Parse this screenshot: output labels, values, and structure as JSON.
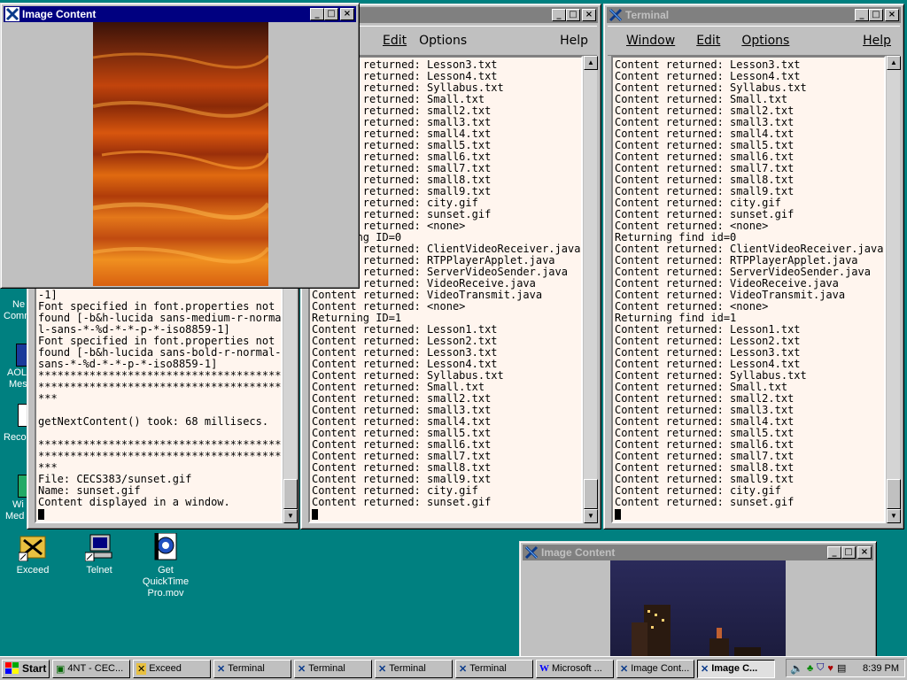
{
  "terminal_mid": {
    "menu": [
      "Edit",
      "Options",
      "Help"
    ],
    "lines": [
      "Content returned: Lesson3.txt",
      "Content returned: Lesson4.txt",
      "Content returned: Syllabus.txt",
      "Content returned: Small.txt",
      "Content returned: small2.txt",
      "Content returned: small3.txt",
      "Content returned: small4.txt",
      "Content returned: small5.txt",
      "Content returned: small6.txt",
      "Content returned: small7.txt",
      "Content returned: small8.txt",
      "Content returned: small9.txt",
      "Content returned: city.gif",
      "Content returned: sunset.gif",
      "Content returned: <none>",
      "Returning ID=0",
      "Content returned: ClientVideoReceiver.java",
      "Content returned: RTPPlayerApplet.java",
      "Content returned: ServerVideoSender.java",
      "Content returned: VideoReceive.java",
      "Content returned: VideoTransmit.java",
      "Content returned: <none>",
      "Returning ID=1",
      "Content returned: Lesson1.txt",
      "Content returned: Lesson2.txt",
      "Content returned: Lesson3.txt",
      "Content returned: Lesson4.txt",
      "Content returned: Syllabus.txt",
      "Content returned: Small.txt",
      "Content returned: small2.txt",
      "Content returned: small3.txt",
      "Content returned: small4.txt",
      "Content returned: small5.txt",
      "Content returned: small6.txt",
      "Content returned: small7.txt",
      "Content returned: small8.txt",
      "Content returned: small9.txt",
      "Content returned: city.gif",
      "Content returned: sunset.gif"
    ]
  },
  "terminal_right": {
    "title": "Terminal",
    "menu": [
      "Window",
      "Edit",
      "Options",
      "Help"
    ],
    "lines": [
      "Content returned: Lesson3.txt",
      "Content returned: Lesson4.txt",
      "Content returned: Syllabus.txt",
      "Content returned: Small.txt",
      "Content returned: small2.txt",
      "Content returned: small3.txt",
      "Content returned: small4.txt",
      "Content returned: small5.txt",
      "Content returned: small6.txt",
      "Content returned: small7.txt",
      "Content returned: small8.txt",
      "Content returned: small9.txt",
      "Content returned: city.gif",
      "Content returned: sunset.gif",
      "Content returned: <none>",
      "Returning find id=0",
      "Content returned: ClientVideoReceiver.java",
      "Content returned: RTPPlayerApplet.java",
      "Content returned: ServerVideoSender.java",
      "Content returned: VideoReceive.java",
      "Content returned: VideoTransmit.java",
      "Content returned: <none>",
      "Returning find id=1",
      "Content returned: Lesson1.txt",
      "Content returned: Lesson2.txt",
      "Content returned: Lesson3.txt",
      "Content returned: Lesson4.txt",
      "Content returned: Syllabus.txt",
      "Content returned: Small.txt",
      "Content returned: small2.txt",
      "Content returned: small3.txt",
      "Content returned: small4.txt",
      "Content returned: small5.txt",
      "Content returned: small6.txt",
      "Content returned: small7.txt",
      "Content returned: small8.txt",
      "Content returned: small9.txt",
      "Content returned: city.gif",
      "Content returned: sunset.gif"
    ]
  },
  "terminal_left": {
    "lines": [
      "-1]",
      "Font specified in font.properties not",
      "found [-b&h-lucida sans-medium-r-normal",
      "l-sans-*-%d-*-*-p-*-iso8859-1]",
      "Font specified in font.properties not",
      "found [-b&h-lucida sans-bold-r-normal-",
      "sans-*-%d-*-*-p-*-iso8859-1]",
      "**************************************",
      "**************************************",
      "***",
      "",
      "getNextContent() took: 68 millisecs.",
      "",
      "**************************************",
      "**************************************",
      "***",
      "File: CECS383/sunset.gif",
      "Name: sunset.gif",
      "Content displayed in a window."
    ]
  },
  "image_window_top": {
    "title": "Image Content"
  },
  "image_window_bottom": {
    "title": "Image Content"
  },
  "desktop_icons": [
    {
      "label": "Exceed"
    },
    {
      "label": "Telnet"
    },
    {
      "label": "Get QuickTime Pro.mov"
    }
  ],
  "desktop_partial_labels": [
    "Ne",
    "Comm",
    "AOL",
    "Mes",
    "Reco",
    "Wi",
    "Med"
  ],
  "taskbar": {
    "start": "Start",
    "tasks": [
      "4NT - CEC...",
      "Exceed",
      "Terminal",
      "Terminal",
      "Terminal",
      "Terminal",
      "Microsoft ...",
      "Image Cont...",
      "Image C..."
    ],
    "time": "8:39 PM"
  }
}
